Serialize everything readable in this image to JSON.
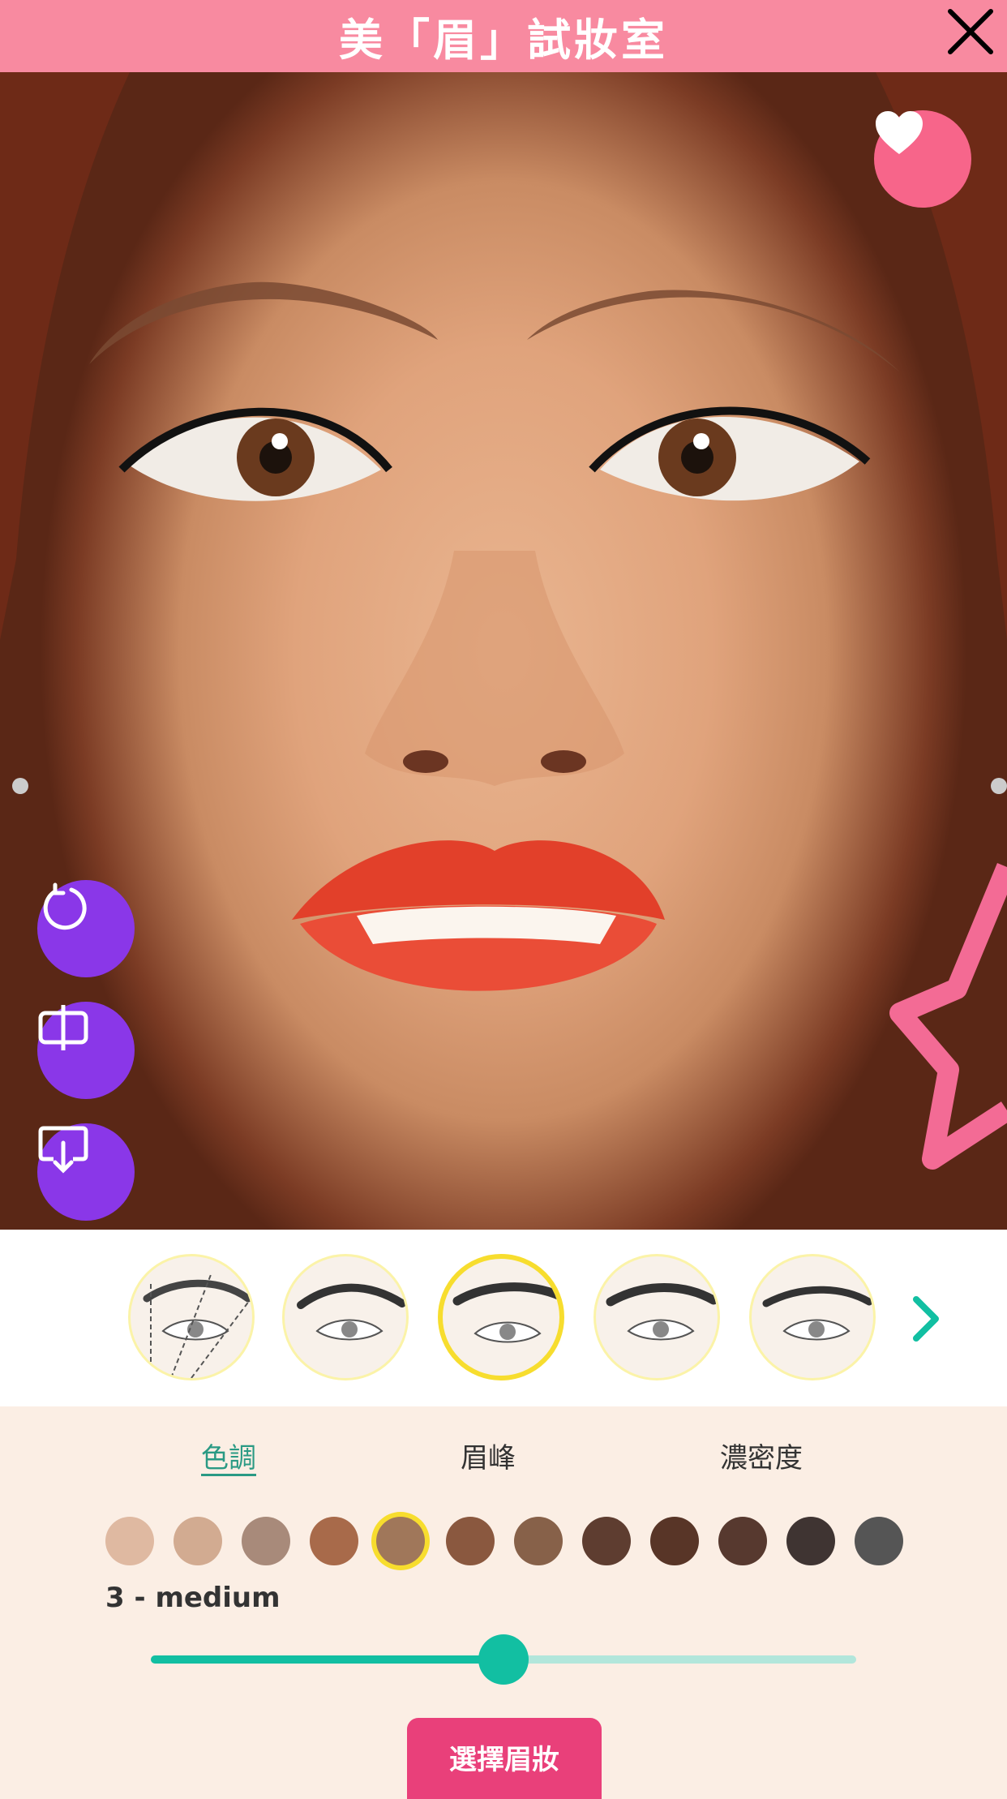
{
  "header": {
    "title": "美「眉」試妝室"
  },
  "icons": {
    "close": "close-icon",
    "favorite": "heart-icon",
    "reset": "reset-icon",
    "compare": "compare-icon",
    "save": "download-icon",
    "next": "chevron-right-icon"
  },
  "colors": {
    "header": "#f88aa0",
    "fab": "#8a37e8",
    "heart": "#f7658a",
    "accent": "#12bfa2",
    "button": "#e9407a",
    "selected_ring": "#f7dd2e"
  },
  "brow_styles": {
    "count": 5,
    "selected_index": 2
  },
  "tabs": [
    {
      "label": "色調",
      "active": true
    },
    {
      "label": "眉峰",
      "active": false
    },
    {
      "label": "濃密度",
      "active": false
    }
  ],
  "swatches": [
    {
      "color": "#dfb9a1"
    },
    {
      "color": "#d2ab91"
    },
    {
      "color": "#a88a7a"
    },
    {
      "color": "#a86a4a"
    },
    {
      "color": "#a0775a",
      "selected": true
    },
    {
      "color": "#8a583f"
    },
    {
      "color": "#876149"
    },
    {
      "color": "#5e3d30"
    },
    {
      "color": "#583527"
    },
    {
      "color": "#57392f"
    },
    {
      "color": "#3f3432"
    },
    {
      "color": "#555555"
    }
  ],
  "shade": {
    "label": "3 - medium"
  },
  "slider": {
    "value": 0.5
  },
  "primary_button": {
    "label": "選擇眉妝"
  }
}
